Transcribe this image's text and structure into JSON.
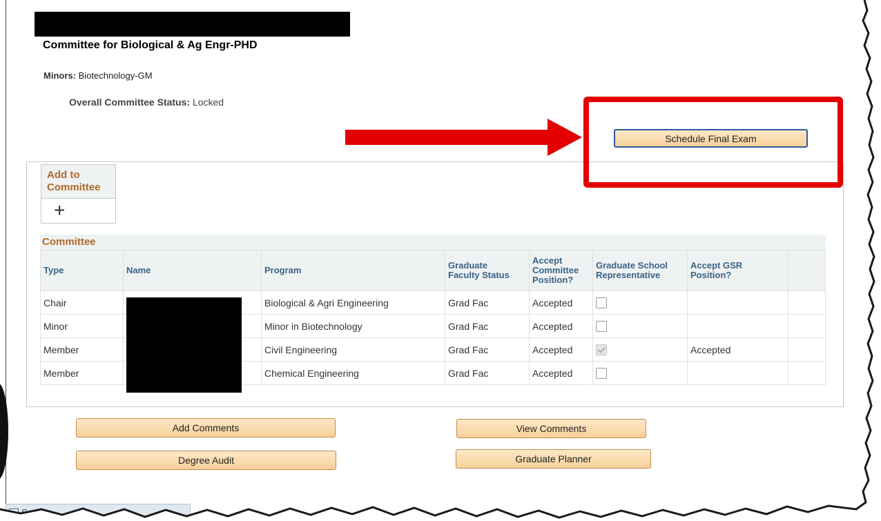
{
  "header": {
    "title": "Committee for Biological & Ag Engr-PHD",
    "minors_label": "Minors:",
    "minors_value": "Biotechnology-GM",
    "status_label": "Overall Committee Status:",
    "status_value": "Locked"
  },
  "actions": {
    "schedule_final_exam": "Schedule Final Exam",
    "add_comments": "Add Comments",
    "view_comments": "View Comments",
    "degree_audit": "Degree Audit",
    "graduate_planner": "Graduate Planner"
  },
  "add_to_committee": {
    "label_line1": "Add to",
    "label_line2": "Committee",
    "icon": "plus-icon"
  },
  "grid": {
    "title": "Committee",
    "headers": {
      "type": "Type",
      "name": "Name",
      "program": "Program",
      "faculty_status_1": "Graduate",
      "faculty_status_2": "Faculty Status",
      "accept_1": "Accept",
      "accept_2": "Committee",
      "accept_3": "Position?",
      "gsr_1": "Graduate School",
      "gsr_2": "Representative",
      "accept_gsr_1": "Accept GSR",
      "accept_gsr_2": "Position?"
    },
    "rows": [
      {
        "type": "Chair",
        "program": "Biological & Agri Engineering",
        "faculty_status": "Grad Fac",
        "accept": "Accepted",
        "gsr_checked": false,
        "accept_gsr": ""
      },
      {
        "type": "Minor",
        "program": "Minor in Biotechnology",
        "faculty_status": "Grad Fac",
        "accept": "Accepted",
        "gsr_checked": false,
        "accept_gsr": ""
      },
      {
        "type": "Member",
        "program": "Civil Engineering",
        "faculty_status": "Grad Fac",
        "accept": "Accepted",
        "gsr_checked": true,
        "accept_gsr": "Accepted"
      },
      {
        "type": "Member",
        "program": "Chemical Engineering",
        "faculty_status": "Grad Fac",
        "accept": "Accepted",
        "gsr_checked": false,
        "accept_gsr": ""
      }
    ]
  },
  "annotation": {
    "color": "#e30000"
  },
  "taskbar": {
    "text": "Se"
  }
}
